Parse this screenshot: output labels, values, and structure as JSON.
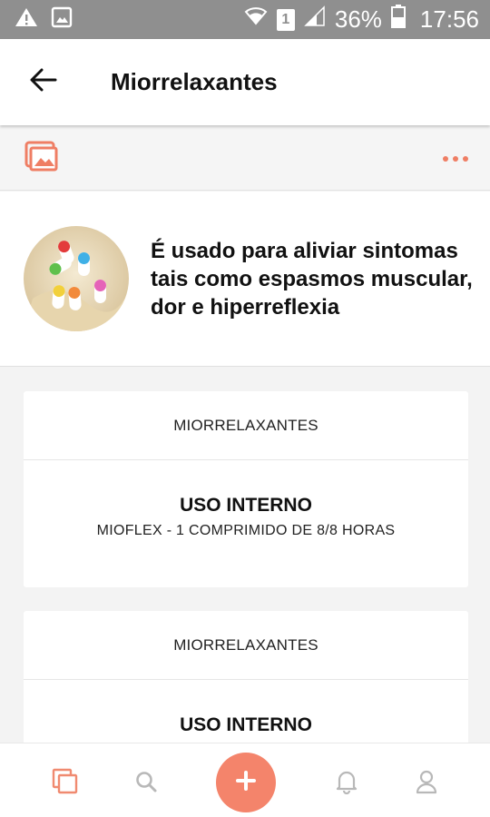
{
  "status_bar": {
    "battery_percent": "36%",
    "time": "17:56",
    "sim_slot": "1"
  },
  "app_bar": {
    "title": "Miorrelaxantes"
  },
  "description": "É usado para aliviar sintomas tais como espasmos muscular, dor e hiperreflexia",
  "cards": [
    {
      "category": "MIORRELAXANTES",
      "heading": "USO INTERNO",
      "instruction": "MIOFLEX - 1 COMPRIMIDO DE 8/8 HORAS"
    },
    {
      "category": "MIORRELAXANTES",
      "heading": "USO INTERNO",
      "instruction": ""
    }
  ],
  "bottom_nav": {
    "items": [
      "copy-icon",
      "search-icon",
      "plus-icon",
      "bell-icon",
      "user-icon"
    ]
  },
  "colors": {
    "accent": "#f4846b",
    "status_bar": "#8f8f8f"
  }
}
